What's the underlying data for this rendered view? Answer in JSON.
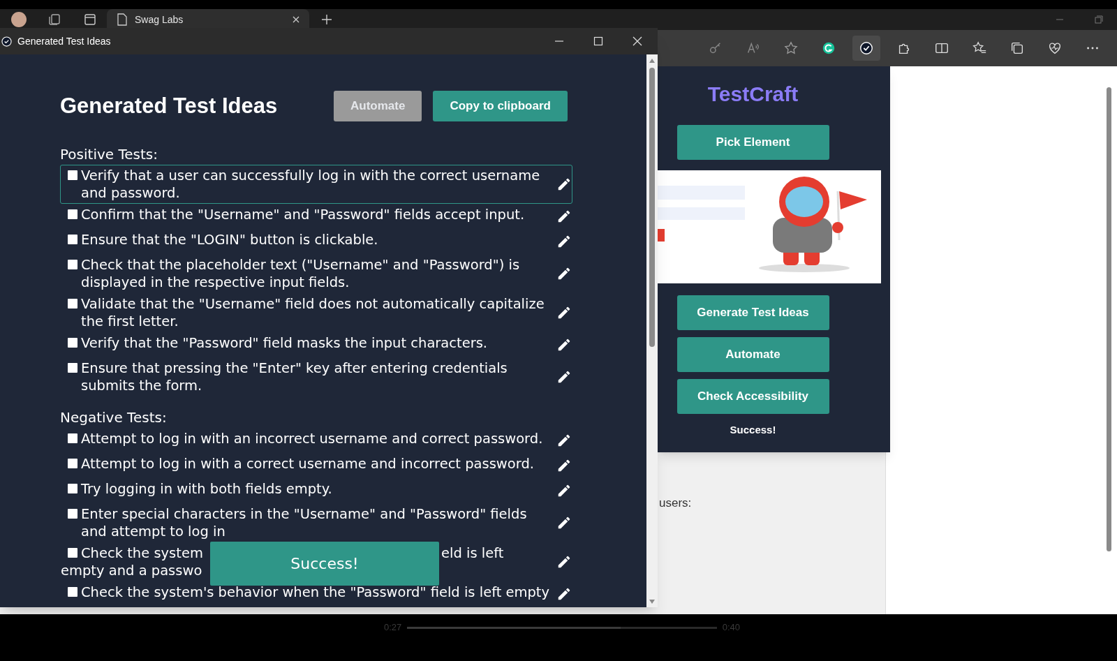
{
  "browser": {
    "tab": {
      "title": "Swag Labs"
    }
  },
  "popup": {
    "title": "Generated Test Ideas",
    "heading": "Generated Test Ideas",
    "buttons": [
      {
        "label": "Automate",
        "disabled": true
      },
      {
        "label": "Copy to clipboard",
        "disabled": false
      }
    ],
    "sections": [
      {
        "title": "Positive Tests:",
        "items": [
          {
            "kind": "plain",
            "text": "Verify that a user can successfully log in with the correct username and password.",
            "checked": false,
            "focused": true
          },
          {
            "kind": "plain",
            "text": "Confirm that the \"Username\" and \"Password\" fields accept input.",
            "checked": false,
            "focused": false
          },
          {
            "kind": "plain",
            "text": "Ensure that the \"LOGIN\" button is clickable.",
            "checked": false,
            "focused": false
          },
          {
            "kind": "plain",
            "text": "Check that the placeholder text (\"Username\" and \"Password\") is displayed in the respective input fields.",
            "checked": false,
            "focused": false
          },
          {
            "kind": "plain",
            "text": "Validate that the \"Username\" field does not automatically capitalize the first letter.",
            "checked": false,
            "focused": false
          },
          {
            "kind": "plain",
            "text": "Verify that the \"Password\" field masks the input characters.",
            "checked": false,
            "focused": false
          },
          {
            "kind": "plain",
            "text": "Ensure that pressing the \"Enter\" key after entering credentials submits the form.",
            "checked": false,
            "focused": false
          }
        ]
      },
      {
        "title": "Negative Tests:",
        "items": [
          {
            "kind": "plain",
            "text": "Attempt to log in with an incorrect username and correct password.",
            "checked": false,
            "focused": false
          },
          {
            "kind": "plain",
            "text": "Attempt to log in with a correct username and incorrect password.",
            "checked": false,
            "focused": false
          },
          {
            "kind": "plain",
            "text": "Try logging in with both fields empty.",
            "checked": false,
            "focused": false
          },
          {
            "kind": "plain",
            "text": "Enter special characters in the \"Username\" and \"Password\" fields and attempt to log in",
            "checked": false,
            "focused": false
          },
          {
            "kind": "covered",
            "fragments": [
              "Check the system",
              "eld is left",
              "empty and a passwo"
            ],
            "checked": false,
            "focused": false
          },
          {
            "kind": "plain",
            "text": "Check the system's behavior when the \"Password\" field is left empty",
            "checked": false,
            "focused": false
          }
        ]
      }
    ],
    "toast": "Success!"
  },
  "extension": {
    "title": "TestCraft",
    "primary_button": "Pick Element",
    "buttons": [
      "Generate Test Ideas",
      "Automate",
      "Check Accessibility"
    ],
    "status": "Success!"
  },
  "page": {
    "text": "users:"
  },
  "video": {
    "elapsed": "0:27",
    "duration": "0:40",
    "level": 0.69
  }
}
